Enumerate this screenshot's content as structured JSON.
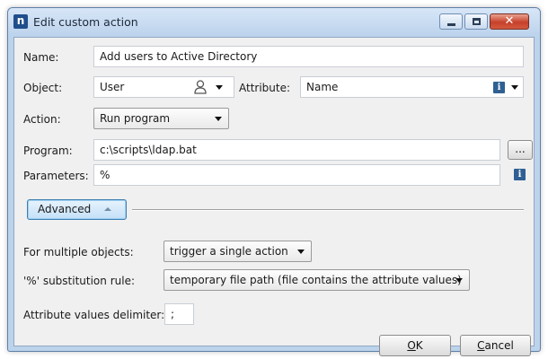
{
  "window": {
    "title": "Edit custom action",
    "app_icon_glyph": "n",
    "close_glyph": "✕"
  },
  "form": {
    "name_label": "Name:",
    "name_value": "Add users to Active Directory",
    "object_label": "Object:",
    "object_value": "User",
    "attribute_label": "Attribute:",
    "attribute_value": "Name",
    "action_label": "Action:",
    "action_value": "Run program",
    "program_label": "Program:",
    "program_value": "c:\\scripts\\ldap.bat",
    "browse_label": "...",
    "parameters_label": "Parameters:",
    "parameters_value": "%",
    "info_glyph": "i"
  },
  "advanced": {
    "toggle_label": "Advanced",
    "multiple_label": "For multiple objects:",
    "multiple_value": "trigger a single action",
    "substitution_label": "'%' substitution rule:",
    "substitution_value": "temporary file path (file contains the attribute values)",
    "delimiter_label": "Attribute values delimiter:",
    "delimiter_value": ";"
  },
  "buttons": {
    "ok_hotkey": "O",
    "ok_rest": "K",
    "cancel_hotkey": "C",
    "cancel_rest": "ancel"
  },
  "icons": {
    "object_icon": "person-icon",
    "info_icon": "info-icon",
    "app_icon": "app-logo-icon"
  },
  "colors": {
    "frame": "#bcd3ec",
    "client": "#f0f0f0",
    "accent": "#3c7fb1",
    "close": "#c7402a"
  }
}
